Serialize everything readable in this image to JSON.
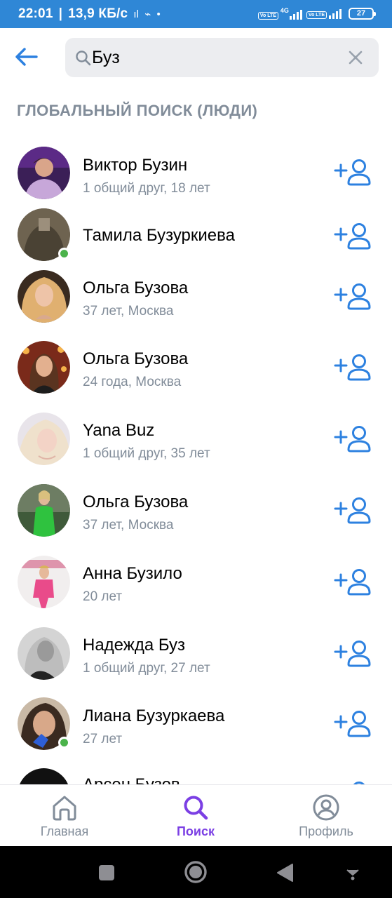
{
  "status_bar": {
    "time": "22:01",
    "speed": "13,9 КБ/с",
    "sim_label": "Vo LTE",
    "network_gen": "4G",
    "battery": "27"
  },
  "search": {
    "query": "Буз",
    "placeholder": ""
  },
  "section_title": "ГЛОБАЛЬНЫЙ ПОИСК (ЛЮДИ)",
  "results": [
    {
      "name": "Виктор Бузин",
      "sub": "1 общий друг, 18 лет",
      "online": false
    },
    {
      "name": "Тамила Бузуркиева",
      "sub": "",
      "online": true
    },
    {
      "name": "Ольга Бузова",
      "sub": "37 лет, Москва",
      "online": false
    },
    {
      "name": "Ольга Бузова",
      "sub": "24 года, Москва",
      "online": false
    },
    {
      "name": "Yana Buz",
      "sub": "1 общий друг, 35 лет",
      "online": false
    },
    {
      "name": "Ольга Бузова",
      "sub": "37 лет, Москва",
      "online": false
    },
    {
      "name": "Анна Бузило",
      "sub": "20 лет",
      "online": false
    },
    {
      "name": "Надежда Буз",
      "sub": "1 общий друг, 27 лет",
      "online": false
    },
    {
      "name": "Лиана Бузуркаева",
      "sub": "27 лет",
      "online": true
    },
    {
      "name": "Арсен Бузов",
      "sub": "",
      "online": false
    }
  ],
  "tabs": [
    {
      "label": "Главная",
      "icon": "home-icon",
      "active": false
    },
    {
      "label": "Поиск",
      "icon": "search-icon",
      "active": true
    },
    {
      "label": "Профиль",
      "icon": "profile-icon",
      "active": false
    }
  ],
  "colors": {
    "accent": "#2d81e0",
    "status_bar": "#2f87d6",
    "active_tab": "#7b3fe4",
    "secondary_text": "#818c99",
    "online": "#4bb34b"
  }
}
